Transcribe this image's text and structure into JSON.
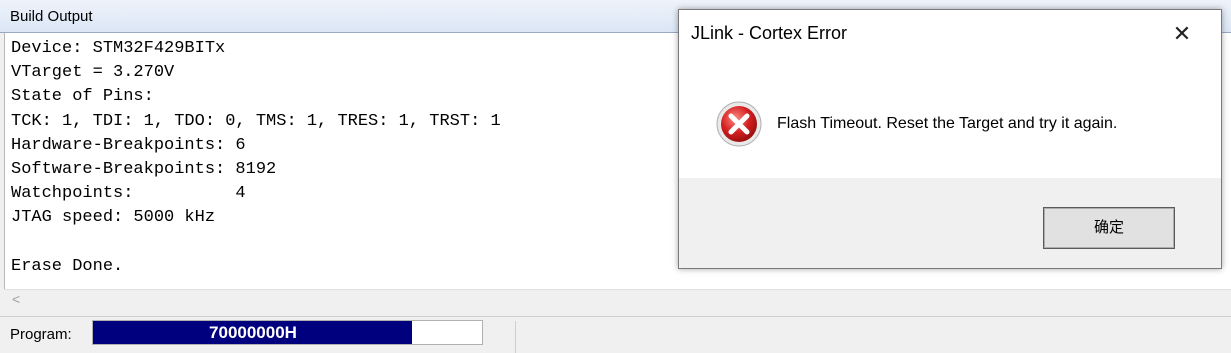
{
  "panel": {
    "title": "Build Output"
  },
  "output": {
    "lines": [
      "Device: STM32F429BITx",
      "VTarget = 3.270V",
      "State of Pins:",
      "TCK: 1, TDI: 1, TDO: 0, TMS: 1, TRES: 1, TRST: 1",
      "Hardware-Breakpoints: 6",
      "Software-Breakpoints: 8192",
      "Watchpoints:          4",
      "JTAG speed: 5000 kHz",
      "",
      "Erase Done."
    ]
  },
  "status": {
    "program_label": "Program:",
    "progress_text": "70000000H",
    "progress_fraction": 0.82,
    "progress_color": "#00007f"
  },
  "dialog": {
    "title": "JLink - Cortex Error",
    "message": "Flash Timeout. Reset the Target and try it again.",
    "ok_label": "确定",
    "icon": "error-icon",
    "icon_color": "#d32020"
  }
}
